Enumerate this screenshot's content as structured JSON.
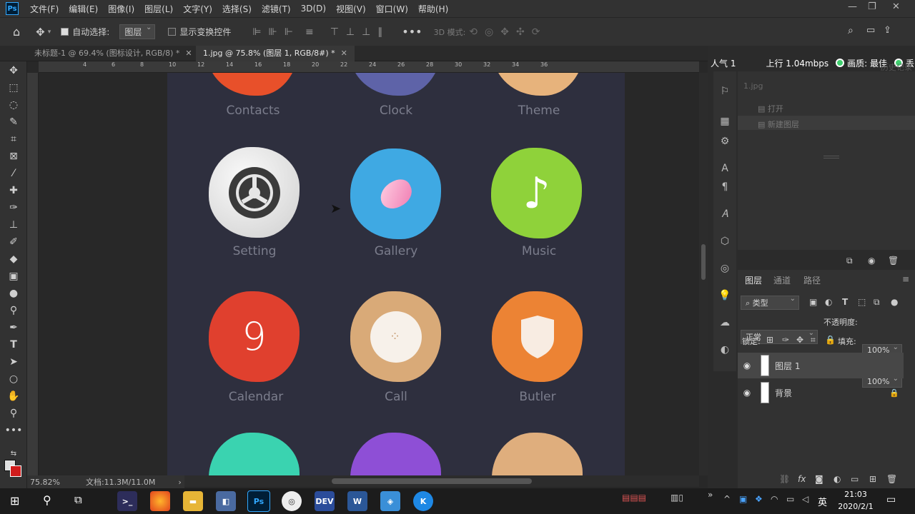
{
  "menubar": {
    "logo": "Ps",
    "items": [
      "文件(F)",
      "编辑(E)",
      "图像(I)",
      "图层(L)",
      "文字(Y)",
      "选择(S)",
      "滤镜(T)",
      "3D(D)",
      "视图(V)",
      "窗口(W)",
      "帮助(H)"
    ]
  },
  "options": {
    "auto_select_label": "自动选择:",
    "auto_select_value": "图层",
    "show_transform_label": "显示变换控件",
    "mode3d_label": "3D 模式:"
  },
  "tabs": [
    {
      "label": "未标题-1 @ 69.4% (图标设计, RGB/8) *"
    },
    {
      "label": "1.jpg @ 75.8% (图层 1, RGB/8#) *"
    }
  ],
  "ruler_top": [
    "4",
    "6",
    "8",
    "10",
    "12",
    "14",
    "16",
    "18",
    "20",
    "22",
    "24",
    "26",
    "28",
    "30",
    "32",
    "34",
    "36"
  ],
  "apps": {
    "row0": [
      "Contacts",
      "Clock",
      "Theme"
    ],
    "row1": [
      "Setting",
      "Gallery",
      "Music"
    ],
    "row2": [
      "Calendar",
      "Call",
      "Butler"
    ],
    "calendar_digit": "9"
  },
  "colors": {
    "contacts": "#e8502a",
    "clock": "#5e63a8",
    "theme": "#e7b37c",
    "setting": "#e4e4e4",
    "gallery": "#3fa9e3",
    "music": "#8fd23a",
    "calendar": "#e0402e",
    "call": "#d9aa78",
    "butler": "#ec8334",
    "row3_a": "#3ad3b0",
    "row3_b": "#8e4fd6",
    "row3_c": "#dfae7d"
  },
  "status": {
    "zoom": "75.82%",
    "doc": "文档:11.3M/11.0M"
  },
  "stream": {
    "viewers": "人气 1",
    "upload": "上行 1.04mbps",
    "quality": "画质: 最佳",
    "extra": "丢"
  },
  "history": {
    "title": "历史记录",
    "file": "1.jpg",
    "items": [
      "打开",
      "新建图层"
    ]
  },
  "layers": {
    "tabs": [
      "图层",
      "通道",
      "路径"
    ],
    "filter": "类型",
    "blend": "正常",
    "opacity_label": "不透明度:",
    "opacity": "100%",
    "lock_label": "锁定:",
    "fill_label": "填充:",
    "fill": "100%",
    "rows": [
      {
        "name": "图层 1"
      },
      {
        "name": "背景"
      }
    ]
  },
  "taskbar": {
    "time": "21:03",
    "date": "2020/2/1",
    "ime": "英"
  }
}
